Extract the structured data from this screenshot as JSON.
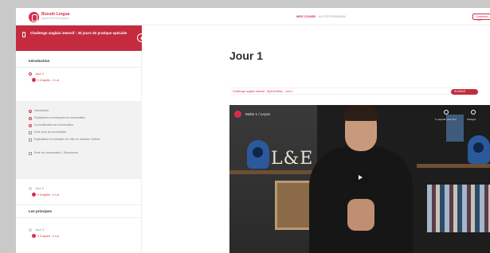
{
  "brand": {
    "name": "Boostir Lingua",
    "tagline": "apprendre les langues",
    "accent": "#d42f47"
  },
  "topbar": {
    "nav": [
      {
        "label": "MES COURS",
        "active": true
      },
      {
        "label": "ACCÈS PREMIUM",
        "active": false
      }
    ],
    "cta_label": "Contactez-nous"
  },
  "sidebar": {
    "course_title": "Challenge anglais intensif : 30 jours de pratique spéciale",
    "sections": [
      {
        "title": "Introduction",
        "days": [
          {
            "name": "Jour 1",
            "progress": "0 Chapitre - 0 Lot",
            "active": true,
            "lessons": [
              {
                "label": "Introduction",
                "icon": "play-icon"
              },
              {
                "label": "Explications et exemples de conversation",
                "icon": "play-icon"
              },
              {
                "label": "La modification de conversation",
                "icon": "play-icon"
              },
              {
                "label": "Texte pour la conversation",
                "icon": "document-icon"
              },
              {
                "label": "Explications et exemples de mise en situation cinéma",
                "icon": "document-icon"
              },
              {
                "label": "Texte de conversation - Ressources",
                "icon": "document-icon"
              }
            ]
          },
          {
            "name": "Jour 2",
            "progress": "0 Chapitre - 0 Lot",
            "active": false
          }
        ]
      },
      {
        "title": "Les principes",
        "days": [
          {
            "name": "Jour 3",
            "progress": "0 Chapitre - 0 Lot",
            "active": false
          }
        ]
      }
    ]
  },
  "main": {
    "page_title": "Jour 1",
    "breadcrumb": "Challenge anglais intensif - Spécial fêtes - Jour 1",
    "next_label": "SUIVANT",
    "video": {
      "channel_title": "Mobe 1 / Leçon",
      "sign": "L&E",
      "controls": [
        {
          "label": "À regarder plus tard",
          "icon": "clock-icon"
        },
        {
          "label": "Partager",
          "icon": "share-icon"
        }
      ]
    }
  }
}
